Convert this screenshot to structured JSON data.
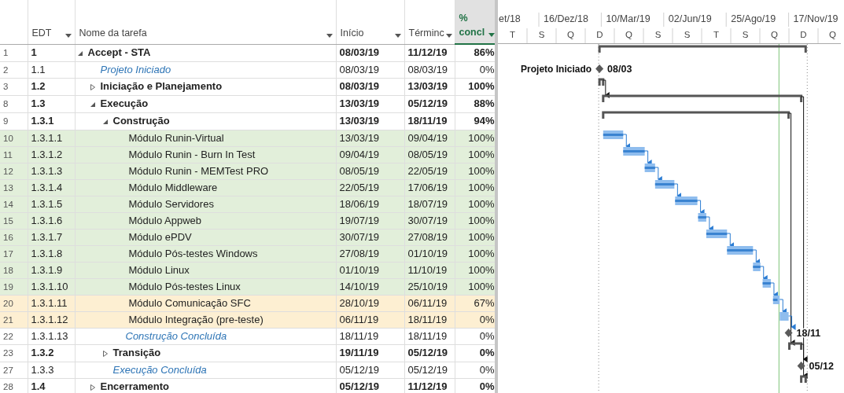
{
  "columns": [
    {
      "label": "EDT",
      "selected": false
    },
    {
      "label": "Nome da tarefa",
      "selected": false
    },
    {
      "label": "Início",
      "selected": false
    },
    {
      "label": "Términc",
      "selected": false
    },
    {
      "label": "% concl",
      "selected": true
    }
  ],
  "timescale": {
    "top": [
      "et/18",
      "16/Dez/18",
      "10/Mar/19",
      "02/Jun/19",
      "25/Ago/19",
      "17/Nov/19"
    ],
    "bottom": [
      "T",
      "S",
      "Q",
      "D",
      "Q",
      "S",
      "S",
      "T",
      "S",
      "Q",
      "D",
      "Q"
    ]
  },
  "tasks": [
    {
      "row_number": "1",
      "edt": "1",
      "name": "Accept - STA",
      "start": "08/03/19",
      "finish": "11/12/19",
      "pct": "86%",
      "kind": "summary",
      "expanded": true,
      "children": [
        {
          "row_number": "2",
          "edt": "1.1",
          "name": "Projeto Iniciado",
          "start": "08/03/19",
          "finish": "08/03/19",
          "pct": "0%",
          "kind": "milestone",
          "bar_labels": {
            "left": "Projeto Iniciado",
            "right": "08/03"
          }
        },
        {
          "row_number": "3",
          "edt": "1.2",
          "name": "Iniciação e Planejamento",
          "start": "08/03/19",
          "finish": "13/03/19",
          "pct": "100%",
          "kind": "summary",
          "expanded": false
        },
        {
          "row_number": "8",
          "edt": "1.3",
          "name": "Execução",
          "start": "13/03/19",
          "finish": "05/12/19",
          "pct": "88%",
          "kind": "summary",
          "expanded": true,
          "children": [
            {
              "row_number": "9",
              "edt": "1.3.1",
              "name": "Construção",
              "start": "13/03/19",
              "finish": "18/11/19",
              "pct": "94%",
              "kind": "summary",
              "expanded": true,
              "children": [
                {
                  "row_number": "10",
                  "edt": "1.3.1.1",
                  "name": "Módulo Runin-Virtual",
                  "start": "13/03/19",
                  "finish": "09/04/19",
                  "pct": "100%",
                  "kind": "task",
                  "color": "#e2efda"
                },
                {
                  "row_number": "11",
                  "edt": "1.3.1.2",
                  "name": "Módulo Runin - Burn In Test",
                  "start": "09/04/19",
                  "finish": "08/05/19",
                  "pct": "100%",
                  "kind": "task",
                  "color": "#e2efda"
                },
                {
                  "row_number": "12",
                  "edt": "1.3.1.3",
                  "name": "Módulo Runin - MEMTest PRO",
                  "start": "08/05/19",
                  "finish": "22/05/19",
                  "pct": "100%",
                  "kind": "task",
                  "color": "#e2efda"
                },
                {
                  "row_number": "13",
                  "edt": "1.3.1.4",
                  "name": "Módulo Middleware",
                  "start": "22/05/19",
                  "finish": "17/06/19",
                  "pct": "100%",
                  "kind": "task",
                  "color": "#e2efda"
                },
                {
                  "row_number": "14",
                  "edt": "1.3.1.5",
                  "name": "Módulo Servidores",
                  "start": "18/06/19",
                  "finish": "18/07/19",
                  "pct": "100%",
                  "kind": "task",
                  "color": "#e2efda"
                },
                {
                  "row_number": "15",
                  "edt": "1.3.1.6",
                  "name": "Módulo Appweb",
                  "start": "19/07/19",
                  "finish": "30/07/19",
                  "pct": "100%",
                  "kind": "task",
                  "color": "#e2efda"
                },
                {
                  "row_number": "16",
                  "edt": "1.3.1.7",
                  "name": "Módulo ePDV",
                  "start": "30/07/19",
                  "finish": "27/08/19",
                  "pct": "100%",
                  "kind": "task",
                  "color": "#e2efda"
                },
                {
                  "row_number": "17",
                  "edt": "1.3.1.8",
                  "name": "Módulo Pós-testes Windows",
                  "start": "27/08/19",
                  "finish": "01/10/19",
                  "pct": "100%",
                  "kind": "task",
                  "color": "#e2efda"
                },
                {
                  "row_number": "18",
                  "edt": "1.3.1.9",
                  "name": "Módulo Linux",
                  "start": "01/10/19",
                  "finish": "11/10/19",
                  "pct": "100%",
                  "kind": "task",
                  "color": "#e2efda"
                },
                {
                  "row_number": "19",
                  "edt": "1.3.1.10",
                  "name": "Módulo Pós-testes Linux",
                  "start": "14/10/19",
                  "finish": "25/10/19",
                  "pct": "100%",
                  "kind": "task",
                  "color": "#e2efda"
                },
                {
                  "row_number": "20",
                  "edt": "1.3.1.11",
                  "name": "Módulo Comunicação SFC",
                  "start": "28/10/19",
                  "finish": "06/11/19",
                  "pct": "67%",
                  "kind": "task",
                  "color": "#fdefd2"
                },
                {
                  "row_number": "21",
                  "edt": "1.3.1.12",
                  "name": "Módulo Integração (pre-teste)",
                  "start": "06/11/19",
                  "finish": "18/11/19",
                  "pct": "0%",
                  "kind": "task",
                  "color": "#fdefd2"
                },
                {
                  "row_number": "22",
                  "edt": "1.3.1.13",
                  "name": "Construção Concluída",
                  "start": "18/11/19",
                  "finish": "18/11/19",
                  "pct": "0%",
                  "kind": "milestone",
                  "bar_labels": {
                    "right": "18/11"
                  }
                }
              ]
            },
            {
              "row_number": "23",
              "edt": "1.3.2",
              "name": "Transição",
              "start": "19/11/19",
              "finish": "05/12/19",
              "pct": "0%",
              "kind": "summary",
              "expanded": false
            },
            {
              "row_number": "27",
              "edt": "1.3.3",
              "name": "Execução Concluída",
              "start": "05/12/19",
              "finish": "05/12/19",
              "pct": "0%",
              "kind": "milestone",
              "bar_labels": {
                "right": "05/12"
              }
            }
          ]
        },
        {
          "row_number": "28",
          "edt": "1.4",
          "name": "Encerramento",
          "start": "05/12/19",
          "finish": "11/12/19",
          "pct": "0%",
          "kind": "summary",
          "expanded": false
        }
      ]
    }
  ]
}
